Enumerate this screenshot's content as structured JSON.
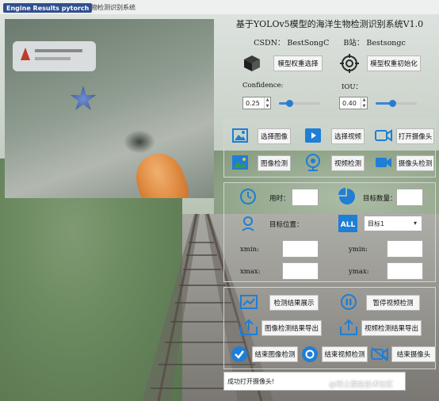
{
  "window": {
    "title": "基于YOLOv5模型的海洋生物检测识别系统",
    "tag": "Engine Results pytorch"
  },
  "header": {
    "app_title": "基于YOLOv5模型的海洋生物检测识别系统V1.0",
    "csdn": "CSDN：  BestSongC",
    "bilibili": "B站：  Bestsongc"
  },
  "model": {
    "select_label": "模型权重选择",
    "init_label": "模型权重初始化"
  },
  "params": {
    "confidence_label": "Confidence:",
    "confidence_value": "0.25",
    "confidence_fraction": 0.25,
    "iou_label": "IOU：",
    "iou_value": "0.40",
    "iou_fraction": 0.4
  },
  "actions": {
    "select_image": "选择图像",
    "select_video": "选择视频",
    "open_camera": "打开摄像头",
    "image_detect": "图像检测",
    "video_detect": "视频检测",
    "camera_detect": "摄像头检测"
  },
  "results": {
    "time_label": "用时：",
    "target_count_label": "目标数量：",
    "target_position_label": "目标位置：",
    "target_select_value": "目标1",
    "xmin_label": "xmin:",
    "ymin_label": "ymin:",
    "xmax_label": "xmax:",
    "ymax_label": "ymax:"
  },
  "bottom_actions": {
    "show_results": "检测结果展示",
    "pause_video": "暂停视频检测",
    "export_image": "图像检测结果导出",
    "export_video": "视频检测结果导出",
    "end_image": "结束图像检测",
    "end_video": "结束视频检测",
    "end_camera": "结束摄像头"
  },
  "status": {
    "message": "成功打开摄像头!"
  },
  "watermark": "@稀土掘金技术社区",
  "colors": {
    "accent": "#2a7bd0",
    "icon_blue": "#1f7ed6"
  }
}
